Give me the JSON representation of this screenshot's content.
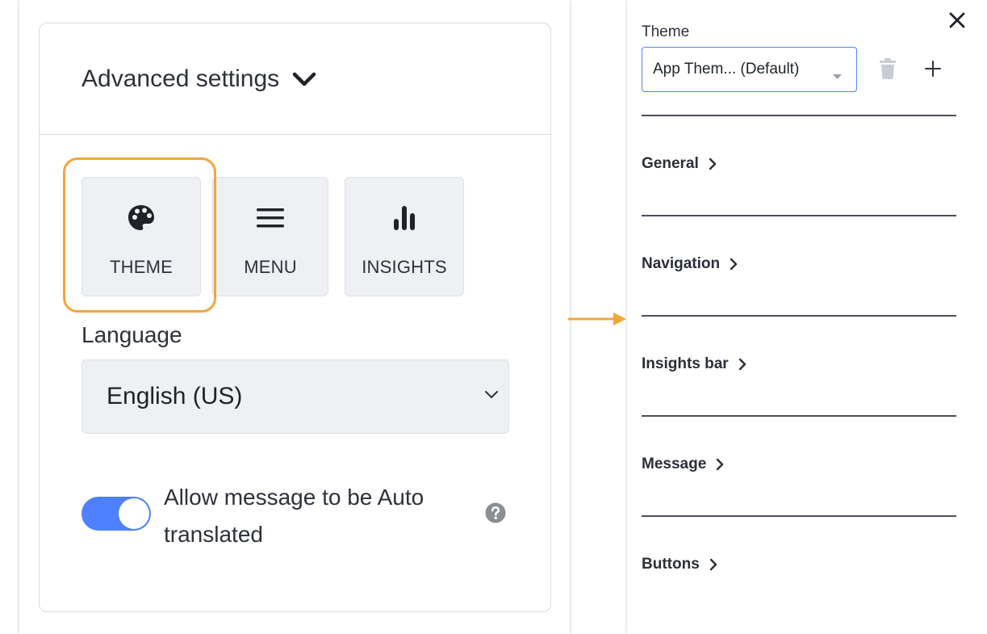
{
  "left_panel": {
    "title": "Advanced settings",
    "tiles": [
      {
        "label": "THEME",
        "icon": "palette-icon"
      },
      {
        "label": "MENU",
        "icon": "hamburger-menu-icon"
      },
      {
        "label": "INSIGHTS",
        "icon": "bar-chart-icon"
      }
    ],
    "language": {
      "label": "Language",
      "value": "English (US)"
    },
    "auto_translate": {
      "label": "Allow message to be Auto translated",
      "enabled": true
    }
  },
  "right_panel": {
    "theme_label": "Theme",
    "theme_value": "App Them...  (Default)",
    "sections": [
      "General",
      "Navigation",
      "Insights bar",
      "Message",
      "Buttons"
    ]
  },
  "colors": {
    "highlight": "#f4a63b",
    "toggle_on": "#4f80ff",
    "select_border": "#4f86f7",
    "tile_bg": "#eef0f3"
  }
}
